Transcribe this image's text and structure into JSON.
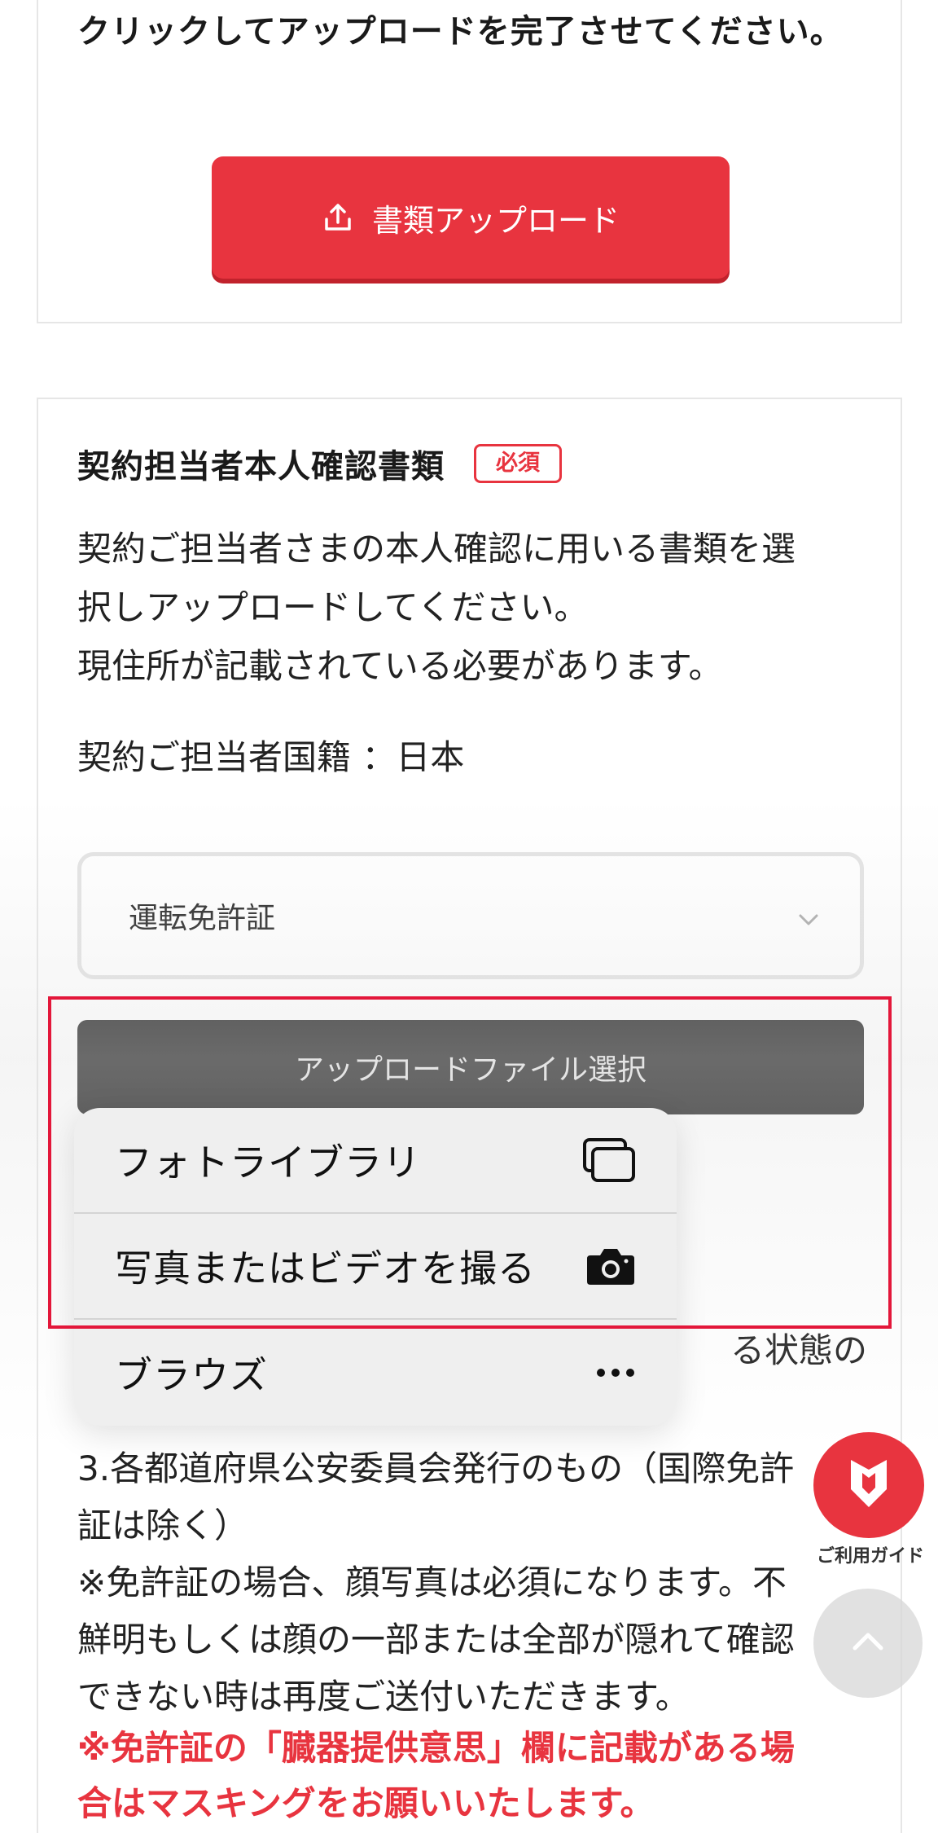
{
  "upload_section": {
    "instruction": "クリックしてアップロードを完了させてください。",
    "upload_button_label": "書類アップロード",
    "upload_icon": "upload-icon"
  },
  "identity_section": {
    "title": "契約担当者本人確認書類",
    "required_badge": "必須",
    "description_lines": [
      "契約ご担当者さまの本人確認に用いる書類を選",
      "択しアップロードしてください。",
      "現住所が記載されている必要があります。"
    ],
    "nationality": "契約ご担当者国籍 ：日本",
    "document_select": {
      "selected": "運転免許証",
      "icon": "chevron-down-icon"
    },
    "file_select_button": "アップロードファイル選択",
    "partial_note": "る状態の",
    "license_lines": [
      "3.各都道府県公安委員会発行のもの（国際免許",
      "証は除く）",
      "※免許証の場合、顔写真は必須になります。不",
      "鮮明もしくは顔の一部または全部が隠れて確認",
      "できない時は再度ご送付いただきます。"
    ],
    "license_warning_lines": [
      "※免許証の「臓器提供意思」欄に記載がある場",
      "合はマスキングをお願いいたします。"
    ]
  },
  "context_menu": {
    "items": [
      {
        "label": "フォトライブラリ",
        "icon": "photo-library-icon"
      },
      {
        "label": "写真またはビデオを撮る",
        "icon": "camera-icon"
      },
      {
        "label": "ブラウズ",
        "icon": "more-icon"
      }
    ]
  },
  "floating": {
    "guide_label": "ご利用ガイド",
    "guide_icon": "guide-shield-icon",
    "scroll_top_icon": "chevron-up-icon"
  },
  "colors": {
    "accent_red": "#e8343f",
    "highlight_red": "#e3173a",
    "dark_button": "#2b2b2b",
    "menu_bg": "#efefef"
  }
}
